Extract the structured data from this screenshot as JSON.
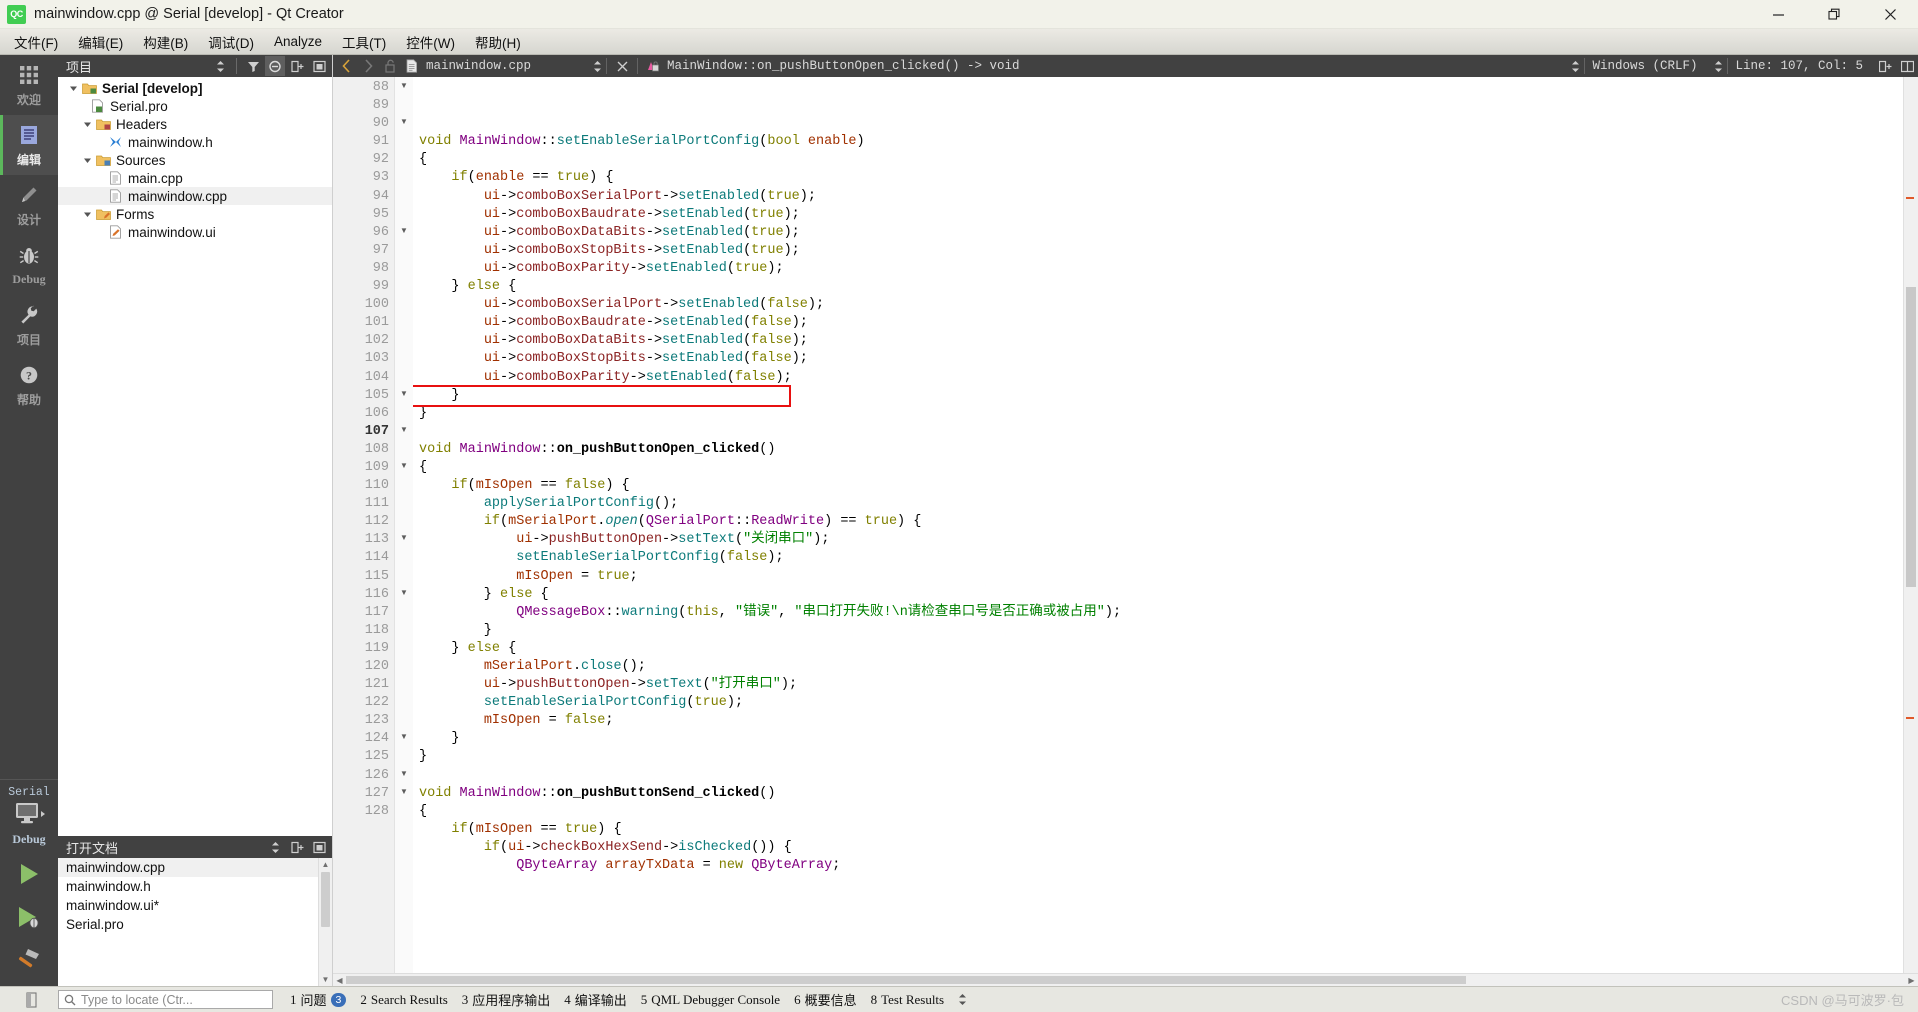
{
  "window": {
    "title": "mainwindow.cpp @ Serial [develop] - Qt Creator",
    "app_badge": "QC",
    "minimize_label": "minimize-icon",
    "restore_label": "restore-icon",
    "close_label": "close-icon"
  },
  "menubar": {
    "items": [
      {
        "label": "文件(F)",
        "key": "F"
      },
      {
        "label": "编辑(E)",
        "key": "E"
      },
      {
        "label": "构建(B)",
        "key": "B"
      },
      {
        "label": "调试(D)",
        "key": "D"
      },
      {
        "label": "Analyze",
        "key": "A"
      },
      {
        "label": "工具(T)",
        "key": "T"
      },
      {
        "label": "控件(W)",
        "key": "W"
      },
      {
        "label": "帮助(H)",
        "key": "H"
      }
    ]
  },
  "modebar": {
    "modes": [
      {
        "label": "欢迎",
        "icon": "grid-icon",
        "active": false
      },
      {
        "label": "编辑",
        "icon": "document-lines-icon",
        "active": true
      },
      {
        "label": "设计",
        "icon": "pencil-icon",
        "active": false
      },
      {
        "label": "Debug",
        "icon": "bug-icon",
        "active": false
      },
      {
        "label": "项目",
        "icon": "wrench-icon",
        "active": false
      },
      {
        "label": "帮助",
        "icon": "question-circle-icon",
        "active": false
      }
    ],
    "kit": {
      "project_name": "Serial",
      "build_config": "Debug",
      "monitor_icon": "desktop-monitor-icon"
    },
    "actions": [
      {
        "name": "run-button",
        "icon": "green-play-icon"
      },
      {
        "name": "debug-button",
        "icon": "green-play-bug-icon"
      },
      {
        "name": "build-button",
        "icon": "hammer-icon"
      }
    ]
  },
  "project_pane": {
    "header": "项目",
    "header_buttons": [
      "filter-icon",
      "sync-icon",
      "add-split-icon",
      "close-split-icon"
    ],
    "tree": [
      {
        "label": "Serial [develop]",
        "indent": 0,
        "arrow": "down",
        "icon": "project-folder-icon",
        "bold": true,
        "selected": false
      },
      {
        "label": "Serial.pro",
        "indent": 1,
        "arrow": "none",
        "icon": "pro-file-icon",
        "bold": false,
        "selected": false
      },
      {
        "label": "Headers",
        "indent": 1,
        "arrow": "down",
        "icon": "headers-folder-icon",
        "bold": false,
        "selected": false
      },
      {
        "label": "mainwindow.h",
        "indent": 2,
        "arrow": "none",
        "icon": "header-file-icon",
        "bold": false,
        "selected": false
      },
      {
        "label": "Sources",
        "indent": 1,
        "arrow": "down",
        "icon": "sources-folder-icon",
        "bold": false,
        "selected": false
      },
      {
        "label": "main.cpp",
        "indent": 2,
        "arrow": "none",
        "icon": "cpp-file-icon",
        "bold": false,
        "selected": false
      },
      {
        "label": "mainwindow.cpp",
        "indent": 2,
        "arrow": "none",
        "icon": "cpp-file-icon",
        "bold": false,
        "selected": true
      },
      {
        "label": "Forms",
        "indent": 1,
        "arrow": "down",
        "icon": "forms-folder-icon",
        "bold": false,
        "selected": false
      },
      {
        "label": "mainwindow.ui",
        "indent": 2,
        "arrow": "none",
        "icon": "ui-file-icon",
        "bold": false,
        "selected": false
      }
    ]
  },
  "open_documents": {
    "header": "打开文档",
    "items": [
      {
        "label": "mainwindow.cpp",
        "selected": true
      },
      {
        "label": "mainwindow.h",
        "selected": false
      },
      {
        "label": "mainwindow.ui*",
        "selected": false
      },
      {
        "label": "Serial.pro",
        "selected": false
      }
    ]
  },
  "editor_toolbar": {
    "back_icon": "chevron-left-icon",
    "forward_icon": "chevron-right-icon",
    "lock_icon": "unlocked-icon",
    "file_icon": "document-icon",
    "file_name": "mainwindow.cpp",
    "close_icon": "close-icon",
    "symbol_icon": "class-symbol-icon",
    "symbol_name": "MainWindow::on_pushButtonOpen_clicked() -> void",
    "line_ending": "Windows (CRLF)",
    "cursor_position": "Line: 107, Col: 5",
    "split_icon": "split-editor-icon",
    "split_side_icon": "split-side-icon",
    "unsplit_icon": "unsplit-icon"
  },
  "code": {
    "first_line": 88,
    "current_line": 107,
    "highlight_box_line": 105,
    "lines": [
      {
        "n": 88,
        "fold": "down",
        "text": "void MainWindow::setEnableSerialPortConfig(bool enable)"
      },
      {
        "n": 89,
        "fold": "",
        "text": "{"
      },
      {
        "n": 90,
        "fold": "down",
        "text": "    if(enable == true) {"
      },
      {
        "n": 91,
        "fold": "",
        "text": "        ui->comboBoxSerialPort->setEnabled(true);"
      },
      {
        "n": 92,
        "fold": "",
        "text": "        ui->comboBoxBaudrate->setEnabled(true);"
      },
      {
        "n": 93,
        "fold": "",
        "text": "        ui->comboBoxDataBits->setEnabled(true);"
      },
      {
        "n": 94,
        "fold": "",
        "text": "        ui->comboBoxStopBits->setEnabled(true);"
      },
      {
        "n": 95,
        "fold": "",
        "text": "        ui->comboBoxParity->setEnabled(true);"
      },
      {
        "n": 96,
        "fold": "down",
        "text": "    } else {"
      },
      {
        "n": 97,
        "fold": "",
        "text": "        ui->comboBoxSerialPort->setEnabled(false);"
      },
      {
        "n": 98,
        "fold": "",
        "text": "        ui->comboBoxBaudrate->setEnabled(false);"
      },
      {
        "n": 99,
        "fold": "",
        "text": "        ui->comboBoxDataBits->setEnabled(false);"
      },
      {
        "n": 100,
        "fold": "",
        "text": "        ui->comboBoxStopBits->setEnabled(false);"
      },
      {
        "n": 101,
        "fold": "",
        "text": "        ui->comboBoxParity->setEnabled(false);"
      },
      {
        "n": 102,
        "fold": "",
        "text": "    }"
      },
      {
        "n": 103,
        "fold": "",
        "text": "}"
      },
      {
        "n": 104,
        "fold": "",
        "text": ""
      },
      {
        "n": 105,
        "fold": "down",
        "text": "void MainWindow::on_pushButtonOpen_clicked()"
      },
      {
        "n": 106,
        "fold": "",
        "text": "{"
      },
      {
        "n": 107,
        "fold": "down",
        "text": "    if(mIsOpen == false) {"
      },
      {
        "n": 108,
        "fold": "",
        "text": "        applySerialPortConfig();"
      },
      {
        "n": 109,
        "fold": "down",
        "text": "        if(mSerialPort.open(QSerialPort::ReadWrite) == true) {"
      },
      {
        "n": 110,
        "fold": "",
        "text": "            ui->pushButtonOpen->setText(\"关闭串口\");"
      },
      {
        "n": 111,
        "fold": "",
        "text": "            setEnableSerialPortConfig(false);"
      },
      {
        "n": 112,
        "fold": "",
        "text": "            mIsOpen = true;"
      },
      {
        "n": 113,
        "fold": "down",
        "text": "        } else {"
      },
      {
        "n": 114,
        "fold": "",
        "text": "            QMessageBox::warning(this, \"错误\", \"串口打开失败!\\n请检查串口号是否正确或被占用\");"
      },
      {
        "n": 115,
        "fold": "",
        "text": "        }"
      },
      {
        "n": 116,
        "fold": "down",
        "text": "    } else {"
      },
      {
        "n": 117,
        "fold": "",
        "text": "        mSerialPort.close();"
      },
      {
        "n": 118,
        "fold": "",
        "text": "        ui->pushButtonOpen->setText(\"打开串口\");"
      },
      {
        "n": 119,
        "fold": "",
        "text": "        setEnableSerialPortConfig(true);"
      },
      {
        "n": 120,
        "fold": "",
        "text": "        mIsOpen = false;"
      },
      {
        "n": 121,
        "fold": "",
        "text": "    }"
      },
      {
        "n": 122,
        "fold": "",
        "text": "}"
      },
      {
        "n": 123,
        "fold": "",
        "text": ""
      },
      {
        "n": 124,
        "fold": "down",
        "text": "void MainWindow::on_pushButtonSend_clicked()"
      },
      {
        "n": 125,
        "fold": "",
        "text": "{"
      },
      {
        "n": 126,
        "fold": "down",
        "text": "    if(mIsOpen == true) {"
      },
      {
        "n": 127,
        "fold": "down",
        "text": "        if(ui->checkBoxHexSend->isChecked()) {"
      },
      {
        "n": 128,
        "fold": "",
        "text": "            QByteArray arrayTxData = new QByteArray;"
      }
    ]
  },
  "statusbar": {
    "search_placeholder": "Type to locate (Ctr...",
    "search_icon": "magnifier-icon",
    "panes": [
      {
        "num": "1",
        "label": "问题",
        "badge": "3"
      },
      {
        "num": "2",
        "label": "Search Results",
        "badge": ""
      },
      {
        "num": "3",
        "label": "应用程序输出",
        "badge": ""
      },
      {
        "num": "4",
        "label": "编译输出",
        "badge": ""
      },
      {
        "num": "5",
        "label": "QML Debugger Console",
        "badge": ""
      },
      {
        "num": "6",
        "label": "概要信息",
        "badge": ""
      },
      {
        "num": "8",
        "label": "Test Results",
        "badge": ""
      }
    ]
  },
  "watermark": "CSDN @马可波罗·包"
}
